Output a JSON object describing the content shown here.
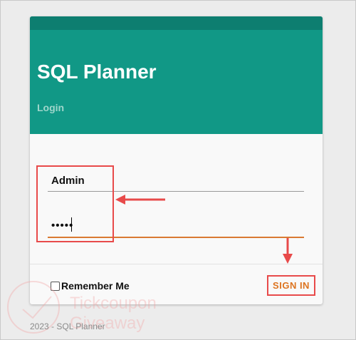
{
  "app": {
    "title": "SQL Planner",
    "subtitle": "Login"
  },
  "form": {
    "username_value": "Admin",
    "password_value": "•••••",
    "remember_label": "Remember Me",
    "remember_checked": false,
    "signin_label": "SIGN IN"
  },
  "footer": {
    "text": "2023 - SQL Planner"
  },
  "watermark": {
    "line1": "Tickcoupon",
    "line2": "Giveaway"
  },
  "colors": {
    "header": "#119886",
    "header_strip": "#0d7e70",
    "accent": "#dd7420",
    "annotation": "#e84a4a"
  }
}
